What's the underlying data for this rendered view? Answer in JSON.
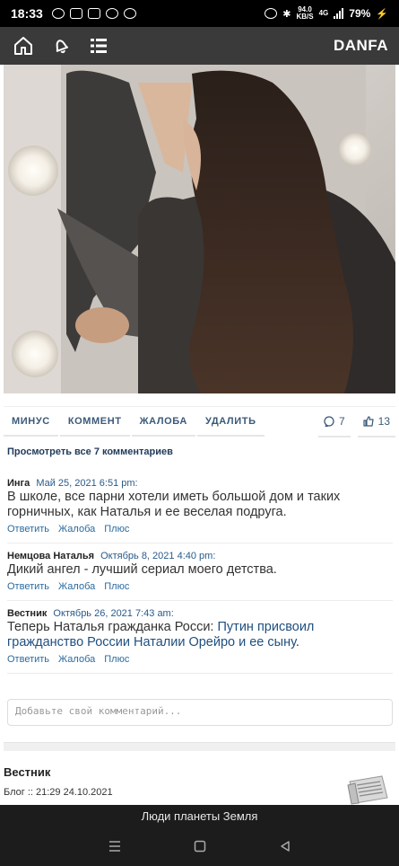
{
  "status_bar": {
    "time": "18:33",
    "speed_value": "94.0",
    "speed_unit": "KB/S",
    "network": "4G",
    "battery": "79%"
  },
  "app_bar": {
    "brand": "DANFA",
    "icons": [
      "home-icon",
      "bell-icon",
      "list-icon"
    ]
  },
  "actions": {
    "minus": "МИНУС",
    "comment": "КОММЕНТ",
    "report": "ЖАЛОБА",
    "delete": "УДАЛИТЬ",
    "comments_count": "7",
    "likes_count": "13"
  },
  "view_all": "Просмотреть все 7 комментариев",
  "comments": [
    {
      "author": "Инга",
      "date": "Май 25, 2021 6:51 pm:",
      "text": "В школе, все парни хотели иметь большой дом и таких горничных, как Наталья и ее веселая подруга.",
      "link_text": "",
      "reply": "Ответить",
      "report": "Жалоба",
      "plus": "Плюс"
    },
    {
      "author": "Немцова Наталья",
      "date": "Октябрь 8, 2021 4:40 pm:",
      "text": "Дикий ангел - лучший сериал моего детства.",
      "link_text": "",
      "reply": "Ответить",
      "report": "Жалоба",
      "plus": "Плюс"
    },
    {
      "author": "Вестник",
      "date": "Октябрь 26, 2021 7:43 am:",
      "text": "Теперь Наталья гражданка Росси: ",
      "link_text": "Путин присвоил гражданство России Наталии Орейро и ее сыну",
      "text_after": ".",
      "reply": "Ответить",
      "report": "Жалоба",
      "plus": "Плюс"
    }
  ],
  "comment_input": {
    "placeholder": "Добавьте свой комментарий..."
  },
  "blog": {
    "author": "Вестник",
    "meta": "Блог :: 21:29 24.10.2021"
  },
  "footer": {
    "caption": "Люди планеты Земля"
  }
}
